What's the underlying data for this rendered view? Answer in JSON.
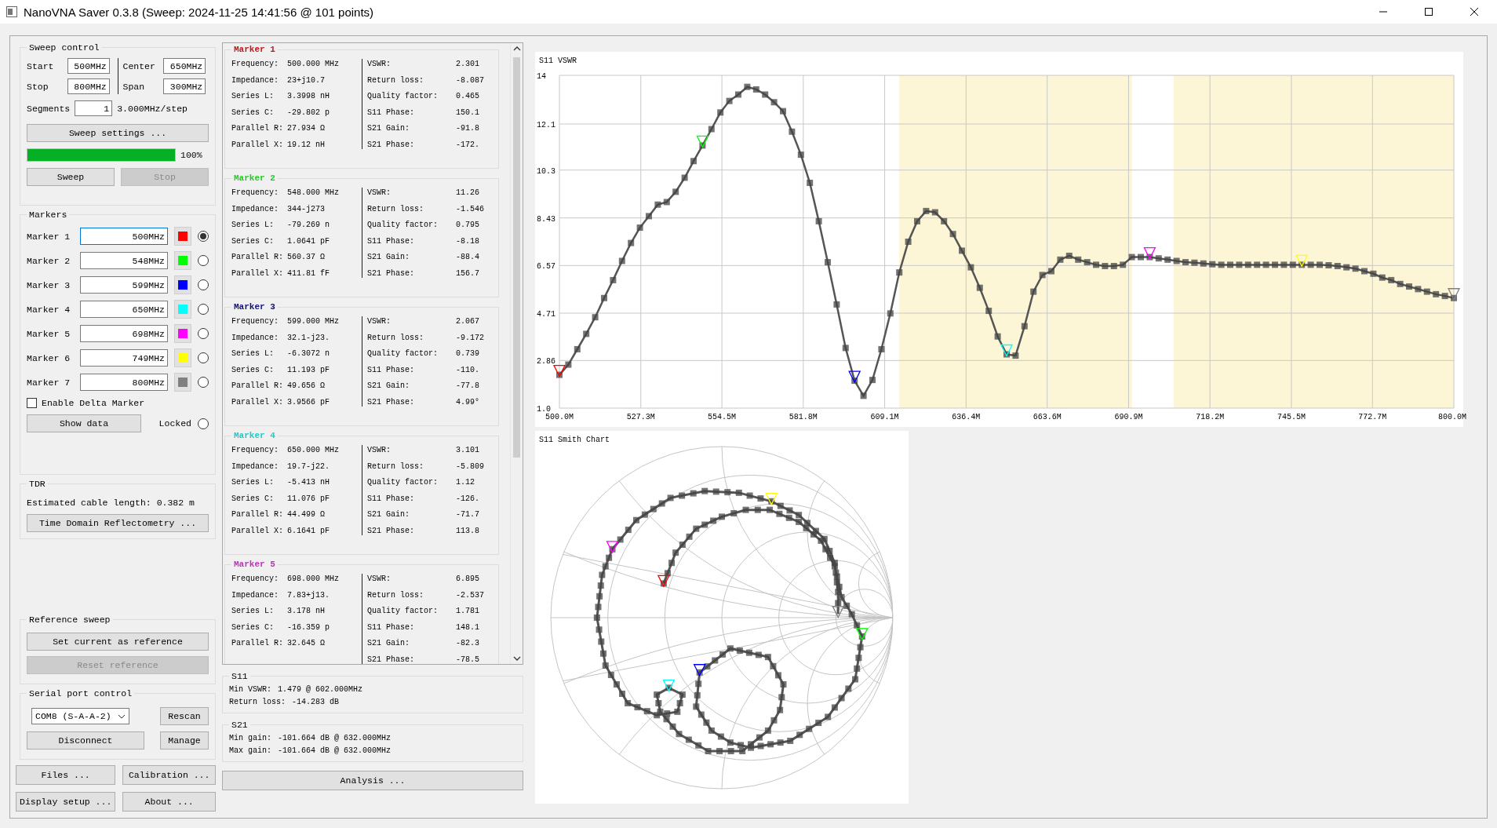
{
  "window": {
    "title": "NanoVNA Saver 0.3.8 (Sweep: 2024-11-25 14:41:56 @ 101 points)"
  },
  "sweep_control": {
    "title": "Sweep control",
    "fields": [
      {
        "label": "Start",
        "value": "500MHz"
      },
      {
        "label": "Center",
        "value": "650MHz"
      },
      {
        "label": "Stop",
        "value": "800MHz"
      },
      {
        "label": "Span",
        "value": "300MHz"
      }
    ],
    "segments": {
      "label": "Segments",
      "value": "1"
    },
    "step": "3.000MHz/step",
    "settings_button": "Sweep settings ...",
    "progress": {
      "level": 1.0,
      "reading": "100%"
    },
    "buttons": [
      {
        "label": "Sweep",
        "disabled": false
      },
      {
        "label": "Stop",
        "disabled": true
      }
    ]
  },
  "markers": {
    "title": "Markers",
    "items": [
      {
        "label": "Marker 1",
        "value": "500MHz",
        "color": "#ff0000",
        "selected": true
      },
      {
        "label": "Marker 2",
        "value": "548MHz",
        "color": "#00ff00",
        "selected": false
      },
      {
        "label": "Marker 3",
        "value": "599MHz",
        "color": "#0000ff",
        "selected": false
      },
      {
        "label": "Marker 4",
        "value": "650MHz",
        "color": "#00ffff",
        "selected": false
      },
      {
        "label": "Marker 5",
        "value": "698MHz",
        "color": "#ff00ff",
        "selected": false
      },
      {
        "label": "Marker 6",
        "value": "749MHz",
        "color": "#ffff00",
        "selected": false
      },
      {
        "label": "Marker 7",
        "value": "800MHz",
        "color": "#808080",
        "selected": false
      }
    ],
    "delta": {
      "label": "Enable Delta Marker",
      "checked": false
    },
    "show_data": "Show data",
    "locked": {
      "label": "Locked",
      "selected": false
    }
  },
  "tdr": {
    "title": "TDR",
    "cable_length": "Estimated cable length: 0.382 m",
    "button": "Time Domain Reflectometry ..."
  },
  "reference_sweep": {
    "title": "Reference sweep",
    "buttons": [
      {
        "label": "Set current as reference",
        "disabled": false
      },
      {
        "label": "Reset reference",
        "disabled": true
      }
    ]
  },
  "serial_port": {
    "title": "Serial port control",
    "port": "COM8 (S-A-A-2)",
    "rescan": "Rescan",
    "disconnect": "Disconnect",
    "manage": "Manage"
  },
  "bottom_buttons": [
    "Files ...",
    "Calibration ...",
    "Display setup ...",
    "About ..."
  ],
  "marker_details": [
    {
      "title": "Marker 1",
      "color": "#c01818",
      "left": [
        {
          "label": "Frequency:",
          "value": "500.000 MHz"
        },
        {
          "label": "Impedance:",
          "value": "23+j10.7"
        },
        {
          "label": "Series L:",
          "value": "3.3998 nH"
        },
        {
          "label": "Series C:",
          "value": "-29.802 p"
        },
        {
          "label": "Parallel R:",
          "value": "27.934 Ω"
        },
        {
          "label": "Parallel X:",
          "value": "19.12 nH"
        }
      ],
      "right": [
        {
          "label": "VSWR:",
          "value": "2.301"
        },
        {
          "label": "Return loss:",
          "value": "-8.087"
        },
        {
          "label": "Quality factor:",
          "value": "0.465"
        },
        {
          "label": "S11 Phase:",
          "value": "150.1"
        },
        {
          "label": "S21 Gain:",
          "value": "-91.8"
        },
        {
          "label": "S21 Phase:",
          "value": "-172."
        }
      ]
    },
    {
      "title": "Marker 2",
      "color": "#22cc22",
      "left": [
        {
          "label": "Frequency:",
          "value": "548.000 MHz"
        },
        {
          "label": "Impedance:",
          "value": "344-j273"
        },
        {
          "label": "Series L:",
          "value": "-79.269 n"
        },
        {
          "label": "Series C:",
          "value": "1.0641 pF"
        },
        {
          "label": "Parallel R:",
          "value": "560.37 Ω"
        },
        {
          "label": "Parallel X:",
          "value": "411.81 fF"
        }
      ],
      "right": [
        {
          "label": "VSWR:",
          "value": "11.26"
        },
        {
          "label": "Return loss:",
          "value": "-1.546"
        },
        {
          "label": "Quality factor:",
          "value": "0.795"
        },
        {
          "label": "S11 Phase:",
          "value": "-8.18"
        },
        {
          "label": "S21 Gain:",
          "value": "-88.4"
        },
        {
          "label": "S21 Phase:",
          "value": "156.7"
        }
      ]
    },
    {
      "title": "Marker 3",
      "color": "#101080",
      "left": [
        {
          "label": "Frequency:",
          "value": "599.000 MHz"
        },
        {
          "label": "Impedance:",
          "value": "32.1-j23."
        },
        {
          "label": "Series L:",
          "value": "-6.3072 n"
        },
        {
          "label": "Series C:",
          "value": "11.193 pF"
        },
        {
          "label": "Parallel R:",
          "value": "49.656 Ω"
        },
        {
          "label": "Parallel X:",
          "value": "3.9566 pF"
        }
      ],
      "right": [
        {
          "label": "VSWR:",
          "value": "2.067"
        },
        {
          "label": "Return loss:",
          "value": "-9.172"
        },
        {
          "label": "Quality factor:",
          "value": "0.739"
        },
        {
          "label": "S11 Phase:",
          "value": "-110."
        },
        {
          "label": "S21 Gain:",
          "value": "-77.8"
        },
        {
          "label": "S21 Phase:",
          "value": "4.99°"
        }
      ]
    },
    {
      "title": "Marker 4",
      "color": "#22c8c8",
      "left": [
        {
          "label": "Frequency:",
          "value": "650.000 MHz"
        },
        {
          "label": "Impedance:",
          "value": "19.7-j22."
        },
        {
          "label": "Series L:",
          "value": "-5.413 nH"
        },
        {
          "label": "Series C:",
          "value": "11.076 pF"
        },
        {
          "label": "Parallel R:",
          "value": "44.499 Ω"
        },
        {
          "label": "Parallel X:",
          "value": "6.1641 pF"
        }
      ],
      "right": [
        {
          "label": "VSWR:",
          "value": "3.101"
        },
        {
          "label": "Return loss:",
          "value": "-5.809"
        },
        {
          "label": "Quality factor:",
          "value": "1.12"
        },
        {
          "label": "S11 Phase:",
          "value": "-126."
        },
        {
          "label": "S21 Gain:",
          "value": "-71.7"
        },
        {
          "label": "S21 Phase:",
          "value": "113.8"
        }
      ]
    },
    {
      "title": "Marker 5",
      "color": "#c030c0",
      "left": [
        {
          "label": "Frequency:",
          "value": "698.000 MHz"
        },
        {
          "label": "Impedance:",
          "value": "7.83+j13."
        },
        {
          "label": "Series L:",
          "value": "3.178 nH"
        },
        {
          "label": "Series C:",
          "value": "-16.359 p"
        },
        {
          "label": "Parallel R:",
          "value": "32.645 Ω"
        }
      ],
      "right": [
        {
          "label": "VSWR:",
          "value": "6.895"
        },
        {
          "label": "Return loss:",
          "value": "-2.537"
        },
        {
          "label": "Quality factor:",
          "value": "1.781"
        },
        {
          "label": "S11 Phase:",
          "value": "148.1"
        },
        {
          "label": "S21 Gain:",
          "value": "-82.3"
        },
        {
          "label": "S21 Phase:",
          "value": "-78.5"
        }
      ]
    }
  ],
  "s11": {
    "title": "S11",
    "rows": [
      {
        "label": "Min VSWR:",
        "value": "1.479 @ 602.000MHz"
      },
      {
        "label": "Return loss:",
        "value": "-14.283 dB"
      }
    ]
  },
  "s21": {
    "title": "S21",
    "rows": [
      {
        "label": "Min gain:",
        "value": "-101.664 dB @ 632.000MHz"
      },
      {
        "label": "Max gain:",
        "value": "-101.664 dB @ 632.000MHz"
      }
    ]
  },
  "analysis_button": "Analysis ...",
  "vswr_chart": {
    "chart_data": {
      "type": "line",
      "title": "S11 VSWR",
      "grid": true,
      "x": [
        500,
        503,
        506,
        509,
        512,
        515,
        518,
        521,
        524,
        527,
        530,
        533,
        536,
        539,
        542,
        545,
        548,
        551,
        554,
        557,
        560,
        563,
        566,
        569,
        572,
        575,
        578,
        581,
        584,
        587,
        590,
        593,
        596,
        599,
        602,
        605,
        608,
        611,
        614,
        617,
        620,
        623,
        626,
        629,
        632,
        635,
        638,
        641,
        644,
        647,
        650,
        653,
        656,
        659,
        662,
        665,
        668,
        671,
        674,
        677,
        680,
        683,
        686,
        689,
        692,
        695,
        698,
        701,
        704,
        707,
        710,
        713,
        716,
        719,
        722,
        725,
        728,
        731,
        734,
        737,
        740,
        743,
        746,
        749,
        752,
        755,
        758,
        761,
        764,
        767,
        770,
        773,
        776,
        779,
        782,
        785,
        788,
        791,
        794,
        797,
        800
      ],
      "series": [
        {
          "color": "#555555",
          "marker": "square",
          "values": [
            2.3,
            2.7,
            3.3,
            3.9,
            4.55,
            5.3,
            6.0,
            6.75,
            7.45,
            8.05,
            8.5,
            8.95,
            9.05,
            9.45,
            10.0,
            10.65,
            11.26,
            11.9,
            12.55,
            13.0,
            13.25,
            13.55,
            13.45,
            13.25,
            12.95,
            12.6,
            11.8,
            10.9,
            9.8,
            8.3,
            6.7,
            5.05,
            3.35,
            2.07,
            1.48,
            2.1,
            3.3,
            4.7,
            6.3,
            7.5,
            8.3,
            8.7,
            8.65,
            8.3,
            7.8,
            7.15,
            6.5,
            5.7,
            4.8,
            3.8,
            3.1,
            3.05,
            4.2,
            5.55,
            6.2,
            6.35,
            6.8,
            6.95,
            6.8,
            6.7,
            6.6,
            6.55,
            6.55,
            6.6,
            6.9,
            6.9,
            6.9,
            6.85,
            6.8,
            6.75,
            6.7,
            6.68,
            6.65,
            6.62,
            6.6,
            6.6,
            6.6,
            6.6,
            6.6,
            6.6,
            6.6,
            6.6,
            6.6,
            6.6,
            6.6,
            6.6,
            6.58,
            6.55,
            6.5,
            6.45,
            6.35,
            6.25,
            6.1,
            6.0,
            5.85,
            5.75,
            5.65,
            5.55,
            5.45,
            5.38,
            5.3
          ]
        }
      ],
      "xlim": [
        500,
        800
      ],
      "ylim": [
        1,
        14
      ],
      "xticks": [
        {
          "value": 500,
          "label": "500.0M"
        },
        {
          "value": 527.3,
          "label": "527.3M"
        },
        {
          "value": 554.5,
          "label": "554.5M"
        },
        {
          "value": 581.8,
          "label": "581.8M"
        },
        {
          "value": 609.1,
          "label": "609.1M"
        },
        {
          "value": 636.4,
          "label": "636.4M"
        },
        {
          "value": 663.6,
          "label": "663.6M"
        },
        {
          "value": 690.9,
          "label": "690.9M"
        },
        {
          "value": 718.2,
          "label": "718.2M"
        },
        {
          "value": 745.5,
          "label": "745.5M"
        },
        {
          "value": 772.7,
          "label": "772.7M"
        },
        {
          "value": 800,
          "label": "800.0M"
        }
      ],
      "yticks": [
        {
          "value": 1,
          "label": "1.0"
        },
        {
          "value": 2.86,
          "label": "2.86"
        },
        {
          "value": 4.71,
          "label": "4.71"
        },
        {
          "value": 6.57,
          "label": "6.57"
        },
        {
          "value": 8.43,
          "label": "8.43"
        },
        {
          "value": 10.3,
          "label": "10.3"
        },
        {
          "value": 12.1,
          "label": "12.1"
        },
        {
          "value": 14,
          "label": "14"
        }
      ],
      "bands": [
        {
          "axis": "x",
          "from": 614,
          "to": 692,
          "color": "#fcf5d6"
        },
        {
          "axis": "x",
          "from": 706,
          "to": 800,
          "color": "#fcf5d6"
        }
      ]
    }
  },
  "smith_chart": {
    "title": "S11 Smith Chart"
  }
}
